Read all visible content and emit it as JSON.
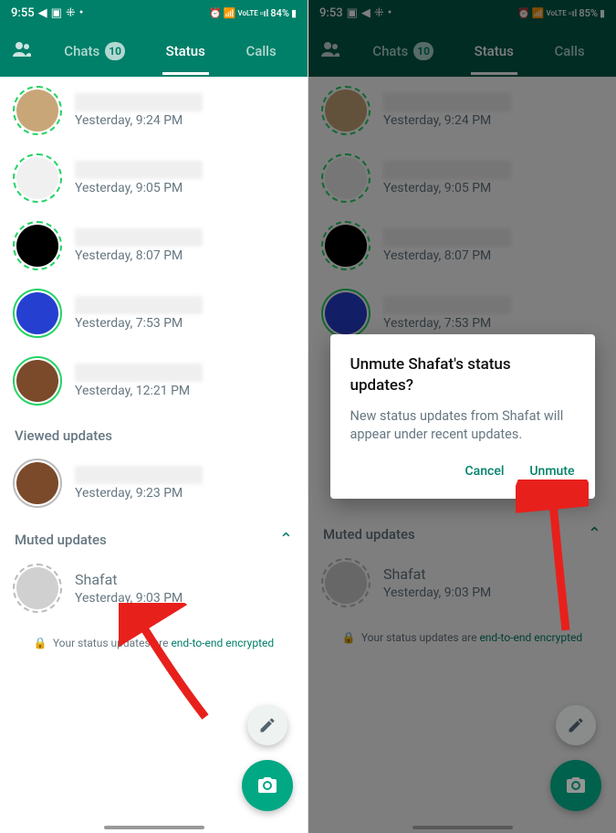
{
  "left": {
    "statusbar": {
      "time": "9:55",
      "battery": "84%",
      "net": "VoLTE"
    },
    "tabs": {
      "chats": "Chats",
      "chats_badge": "10",
      "status": "Status",
      "calls": "Calls"
    },
    "statuses": [
      {
        "time": "Yesterday, 9:24 PM",
        "thumb": "tan"
      },
      {
        "time": "Yesterday, 9:05 PM",
        "thumb": "text"
      },
      {
        "time": "Yesterday, 8:07 PM",
        "thumb": "black"
      },
      {
        "time": "Yesterday, 7:53 PM",
        "thumb": "blue"
      },
      {
        "time": "Yesterday, 12:21 PM",
        "thumb": "brown"
      }
    ],
    "viewed_header": "Viewed updates",
    "viewed": [
      {
        "time": "Yesterday, 9:23 PM",
        "thumb": "brown"
      }
    ],
    "muted_header": "Muted updates",
    "muted": [
      {
        "name": "Shafat",
        "time": "Yesterday, 9:03 PM"
      }
    ],
    "encrypt_pre": "Your status updates are ",
    "encrypt_link": "end-to-end encrypted"
  },
  "right": {
    "statusbar": {
      "time": "9:53",
      "battery": "85%",
      "net": "VoLTE"
    },
    "tabs": {
      "chats": "Chats",
      "chats_badge": "10",
      "status": "Status",
      "calls": "Calls"
    },
    "statuses": [
      {
        "time": "Yesterday, 9:24 PM",
        "thumb": "tan"
      },
      {
        "time": "Yesterday, 9:05 PM",
        "thumb": "text"
      },
      {
        "time": "Yesterday, 8:07 PM",
        "thumb": "black"
      },
      {
        "time": "Yesterday, 7:53 PM",
        "thumb": "blue"
      }
    ],
    "muted_header": "Muted updates",
    "muted": [
      {
        "name": "Shafat",
        "time": "Yesterday, 9:03 PM"
      }
    ],
    "encrypt_pre": "Your status updates are ",
    "encrypt_link": "end-to-end encrypted",
    "dialog": {
      "title": "Unmute Shafat's status updates?",
      "body": "New status updates from Shafat will appear under recent updates.",
      "cancel": "Cancel",
      "confirm": "Unmute"
    }
  }
}
